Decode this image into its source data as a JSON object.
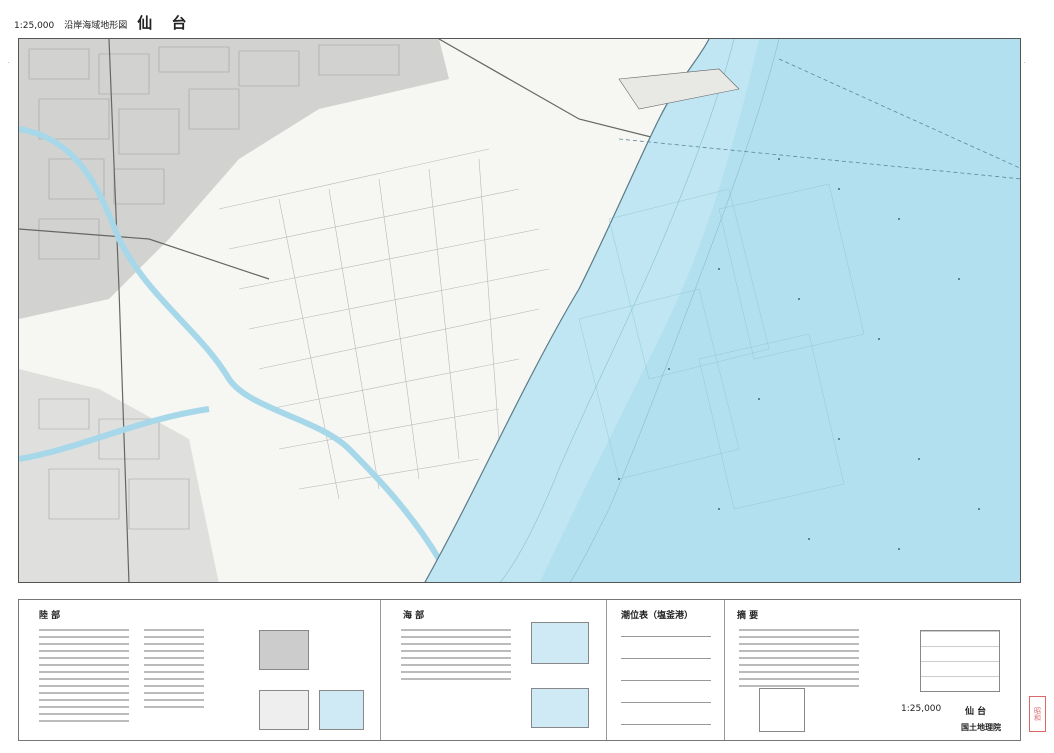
{
  "header": {
    "scale": "1:25,000",
    "series": "沿岸海域地形図",
    "place": "仙  台"
  },
  "legend": {
    "land_heading": "陸  部",
    "sea_heading": "海  部",
    "tide_heading": "潮位表（塩釜港）",
    "notes_heading": "摘  要",
    "scale_label": "1:25,000",
    "place_label": "仙    台",
    "publisher": "国土地理院"
  },
  "stamp": "昭和",
  "colors": {
    "sea": "#bfe6f2",
    "sea_deep": "#9fd6ea",
    "land": "#f6f6f3",
    "urban": "#9a9a9a",
    "river": "#c9e8f3"
  }
}
